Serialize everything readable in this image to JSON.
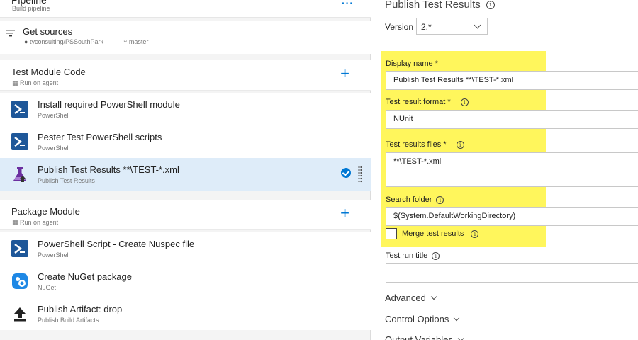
{
  "pipeline": {
    "title": "Pipeline",
    "subtitle": "Build pipeline",
    "more_icon": "ellipsis-icon"
  },
  "get_sources": {
    "title": "Get sources",
    "repo": "tyconsulting/PSSouthPark",
    "branch": "master"
  },
  "phases": [
    {
      "title": "Test Module Code",
      "subtitle": "Run on agent",
      "tasks": [
        {
          "title": "Install required PowerShell module",
          "subtitle": "PowerShell",
          "icon": "powershell-icon"
        },
        {
          "title": "Pester Test PowerShell scripts",
          "subtitle": "PowerShell",
          "icon": "powershell-icon"
        },
        {
          "title": "Publish Test Results **\\TEST-*.xml",
          "subtitle": "Publish Test Results",
          "icon": "flask-icon",
          "selected": true
        }
      ]
    },
    {
      "title": "Package Module",
      "subtitle": "Run on agent",
      "tasks": [
        {
          "title": "PowerShell Script - Create Nuspec file",
          "subtitle": "PowerShell",
          "icon": "powershell-icon"
        },
        {
          "title": "Create NuGet package",
          "subtitle": "NuGet",
          "icon": "nuget-icon"
        },
        {
          "title": "Publish Artifact: drop",
          "subtitle": "Publish Build Artifacts",
          "icon": "upload-icon"
        }
      ]
    }
  ],
  "details": {
    "title": "Publish Test Results",
    "version_label": "Version",
    "version_value": "2.*",
    "display_name_label": "Display name *",
    "display_name_value": "Publish Test Results **\\TEST-*.xml",
    "format_label": "Test result format *",
    "format_value": "NUnit",
    "files_label": "Test results files *",
    "files_value": "**\\TEST-*.xml",
    "search_label": "Search folder",
    "search_value": "$(System.DefaultWorkingDirectory)",
    "merge_label": "Merge test results",
    "run_title_label": "Test run title",
    "run_title_value": "",
    "advanced": "Advanced",
    "control_options": "Control Options",
    "output_variables": "Output Variables"
  },
  "colors": {
    "accent": "#0078d4",
    "highlight": "#fff65c",
    "selected_row": "#deecf9"
  }
}
